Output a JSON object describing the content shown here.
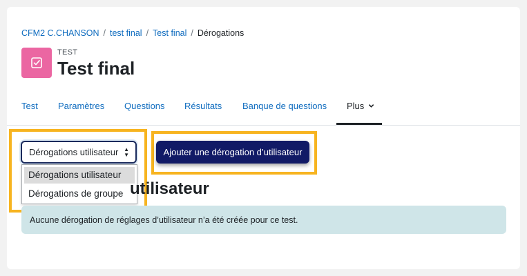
{
  "breadcrumb": {
    "items": [
      "CFM2 C.CHANSON",
      "test final",
      "Test final"
    ],
    "current": "Dérogations"
  },
  "module": {
    "label": "TEST",
    "title": "Test final",
    "icon": "quiz-checkbox-icon",
    "icon_color": "#eb66a2"
  },
  "nav": {
    "items": [
      "Test",
      "Paramètres",
      "Questions",
      "Résultats",
      "Banque de questions"
    ],
    "more": "Plus"
  },
  "overrides": {
    "select_value": "Dérogations utilisateur",
    "options": [
      "Dérogations utilisateur",
      "Dérogations de groupe"
    ],
    "add_button": "Ajouter une dérogation d’utilisateur",
    "section_title_visible": "utilisateur",
    "empty_message": "Aucune dérogation de réglages d’utilisateur n’a été créée pour ce test."
  },
  "colors": {
    "link": "#0f6cbf",
    "primary_button": "#111a66",
    "highlight": "#f7b420",
    "alert_bg": "#cfe5e8"
  }
}
